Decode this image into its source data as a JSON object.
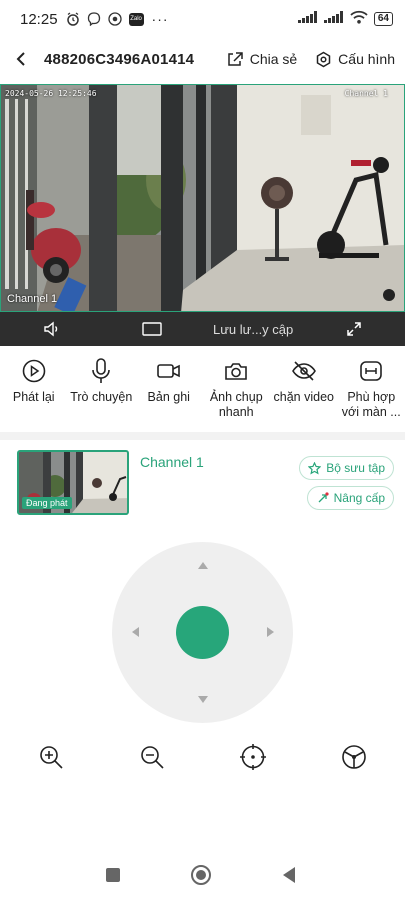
{
  "status_bar": {
    "time": "12:25",
    "zalo": "Zalo",
    "more": "···",
    "battery": "64"
  },
  "header": {
    "device_id": "488206C3496A01414",
    "share_label": "Chia sẻ",
    "config_label": "Cấu hình"
  },
  "video": {
    "timestamp": "2024-05-26 12:25:46",
    "channel_overlay_top": "Channel 1",
    "channel_overlay_bottom": "Channel 1"
  },
  "video_toolbar": {
    "quality_label": "Lưu lư...y cập"
  },
  "actions": [
    {
      "label": "Phát lại",
      "icon": "playback-icon"
    },
    {
      "label": "Trò chuyện",
      "icon": "microphone-icon"
    },
    {
      "label": "Bản ghi",
      "icon": "video-camera-icon"
    },
    {
      "label": "Ảnh chụp nhanh",
      "icon": "camera-icon"
    },
    {
      "label": "chặn video",
      "icon": "eye-off-icon"
    },
    {
      "label": "Phù hợp với màn ...",
      "icon": "fit-screen-icon"
    }
  ],
  "channel": {
    "name": "Channel 1",
    "live_badge": "Đang phát",
    "collection_label": "Bộ sưu tập",
    "upgrade_label": "Nâng cấp"
  },
  "tools": [
    "zoom-in-icon",
    "zoom-out-icon",
    "focus-icon",
    "cruise-icon"
  ],
  "colors": {
    "accent": "#27a67a",
    "toolbar_bg": "#2e2e2e",
    "ptz_bg": "#efefef"
  }
}
